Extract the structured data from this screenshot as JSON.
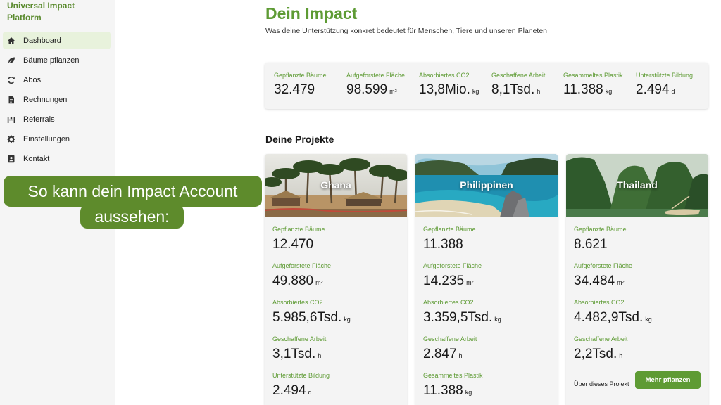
{
  "brand": {
    "line1": "Universal Impact",
    "line2": "Platform"
  },
  "sidebar": {
    "items": [
      {
        "label": "Dashboard",
        "icon": "home-icon"
      },
      {
        "label": "Bäume pflanzen",
        "icon": "leaf-icon"
      },
      {
        "label": "Abos",
        "icon": "refresh-icon"
      },
      {
        "label": "Rechnungen",
        "icon": "document-icon"
      },
      {
        "label": "Referrals",
        "icon": "referral-icon"
      },
      {
        "label": "Einstellungen",
        "icon": "gear-icon"
      },
      {
        "label": "Kontakt",
        "icon": "contact-icon"
      }
    ]
  },
  "callout": {
    "line1": "So kann dein Impact Account",
    "line2": "aussehen:"
  },
  "header": {
    "title": "Dein Impact",
    "subtitle": "Was deine Unterstützung konkret bedeutet für Menschen, Tiere und unseren Planeten"
  },
  "stats": [
    {
      "label": "Gepflanzte Bäume",
      "value": "32.479",
      "unit": ""
    },
    {
      "label": "Aufgeforstete Fläche",
      "value": "98.599",
      "unit": "m²"
    },
    {
      "label": "Absorbiertes CO2",
      "value": "13,8Mio.",
      "unit": "kg"
    },
    {
      "label": "Geschaffene Arbeit",
      "value": "8,1Tsd.",
      "unit": "h"
    },
    {
      "label": "Gesammeltes Plastik",
      "value": "11.388",
      "unit": "kg"
    },
    {
      "label": "Unterstützte Bildung",
      "value": "2.494",
      "unit": "d"
    }
  ],
  "projects_title": "Deine Projekte",
  "projects": [
    {
      "name": "Ghana",
      "metrics": [
        {
          "label": "Gepflanzte Bäume",
          "value": "12.470",
          "unit": ""
        },
        {
          "label": "Aufgeforstete Fläche",
          "value": "49.880",
          "unit": "m²"
        },
        {
          "label": "Absorbiertes CO2",
          "value": "5.985,6Tsd.",
          "unit": "kg"
        },
        {
          "label": "Geschaffene Arbeit",
          "value": "3,1Tsd.",
          "unit": "h"
        },
        {
          "label": "Unterstützte Bildung",
          "value": "2.494",
          "unit": "d"
        }
      ]
    },
    {
      "name": "Philippinen",
      "metrics": [
        {
          "label": "Gepflanzte Bäume",
          "value": "11.388",
          "unit": ""
        },
        {
          "label": "Aufgeforstete Fläche",
          "value": "14.235",
          "unit": "m²"
        },
        {
          "label": "Absorbiertes CO2",
          "value": "3.359,5Tsd.",
          "unit": "kg"
        },
        {
          "label": "Geschaffene Arbeit",
          "value": "2.847",
          "unit": "h"
        },
        {
          "label": "Gesammeltes Plastik",
          "value": "11.388",
          "unit": "kg"
        }
      ]
    },
    {
      "name": "Thailand",
      "metrics": [
        {
          "label": "Gepflanzte Bäume",
          "value": "8.621",
          "unit": ""
        },
        {
          "label": "Aufgeforstete Fläche",
          "value": "34.484",
          "unit": "m²"
        },
        {
          "label": "Absorbiertes CO2",
          "value": "4.482,9Tsd.",
          "unit": "kg"
        },
        {
          "label": "Geschaffene Arbeit",
          "value": "2,2Tsd.",
          "unit": "h"
        }
      ],
      "link": "Über dieses Projekt",
      "button": "Mehr pflanzen"
    }
  ],
  "colors": {
    "accent": "#5e9b34",
    "callout": "#5e8b2c",
    "sidebar_bg": "#f5f5f5",
    "active_bg": "#e8f2dc"
  }
}
